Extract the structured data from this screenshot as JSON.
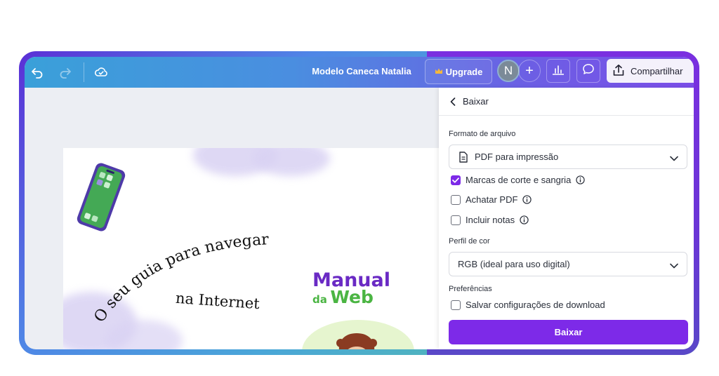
{
  "topbar": {
    "doc_title": "Modelo Caneca Natalia",
    "upgrade_label": "Upgrade",
    "avatar_initial": "N",
    "share_label": "Compartilhar"
  },
  "canvas": {
    "curved_text": "O seu guia para navegar",
    "subtitle": "na Internet",
    "logo_line1": "Manual",
    "logo_line2_small": "da",
    "logo_line2_big": "Web"
  },
  "panel": {
    "back_label": "Baixar",
    "format_label": "Formato de arquivo",
    "format_value": "PDF para impressão",
    "options": [
      {
        "label": "Marcas de corte e sangria",
        "checked": true
      },
      {
        "label": "Achatar PDF",
        "checked": false
      },
      {
        "label": "Incluir notas",
        "checked": false
      }
    ],
    "color_profile_label": "Perfil de cor",
    "color_profile_value": "RGB (ideal para uso digital)",
    "preferences_label": "Preferências",
    "save_settings_label": "Salvar configurações de download",
    "download_button": "Baixar"
  },
  "colors": {
    "accent": "#7d2ae8",
    "logo_purple": "#6a2ac4",
    "logo_green": "#4bb543"
  },
  "icons": [
    "undo-icon",
    "redo-icon",
    "cloud-check-icon",
    "crown-icon",
    "plus-icon",
    "chart-icon",
    "comment-icon",
    "share-upload-icon",
    "chevron-left-icon",
    "document-icon",
    "chevron-down-icon",
    "info-icon",
    "checkmark-icon"
  ]
}
